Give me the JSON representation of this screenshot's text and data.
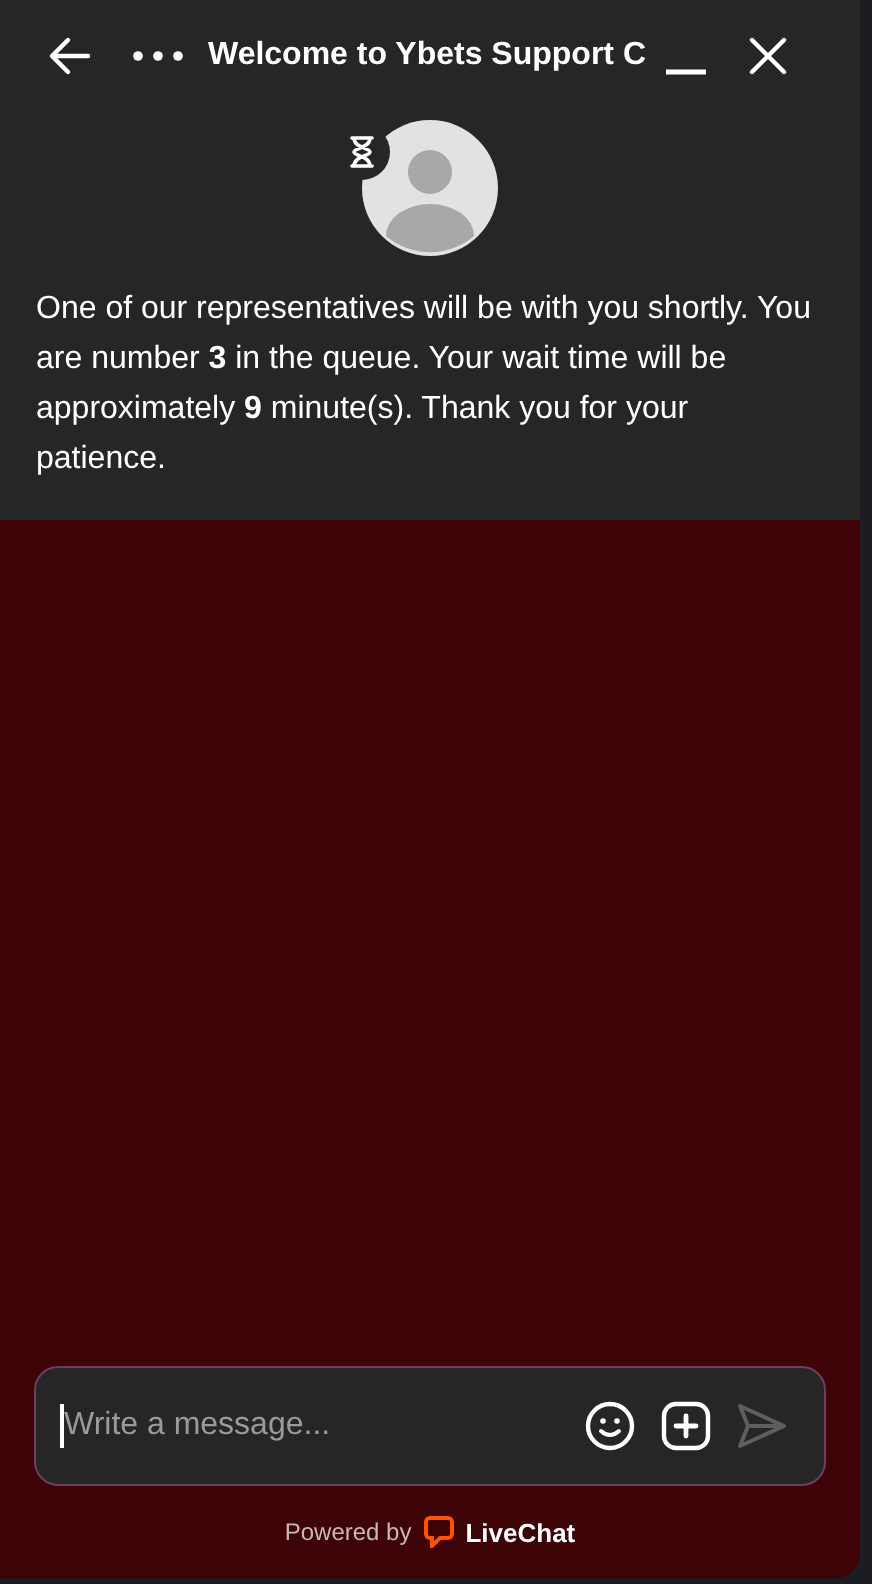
{
  "header": {
    "title": "Welcome to Ybets Support C"
  },
  "message": "One of our representatives will be with you shortly. You are number **3** in the queue. Your wait time will be approximately **9** minute(s). Thank you for your patience.",
  "composer": {
    "placeholder": "Write a message...",
    "send_disabled": true
  },
  "footer": {
    "powered_by": "Powered by",
    "brand": "LiveChat"
  }
}
